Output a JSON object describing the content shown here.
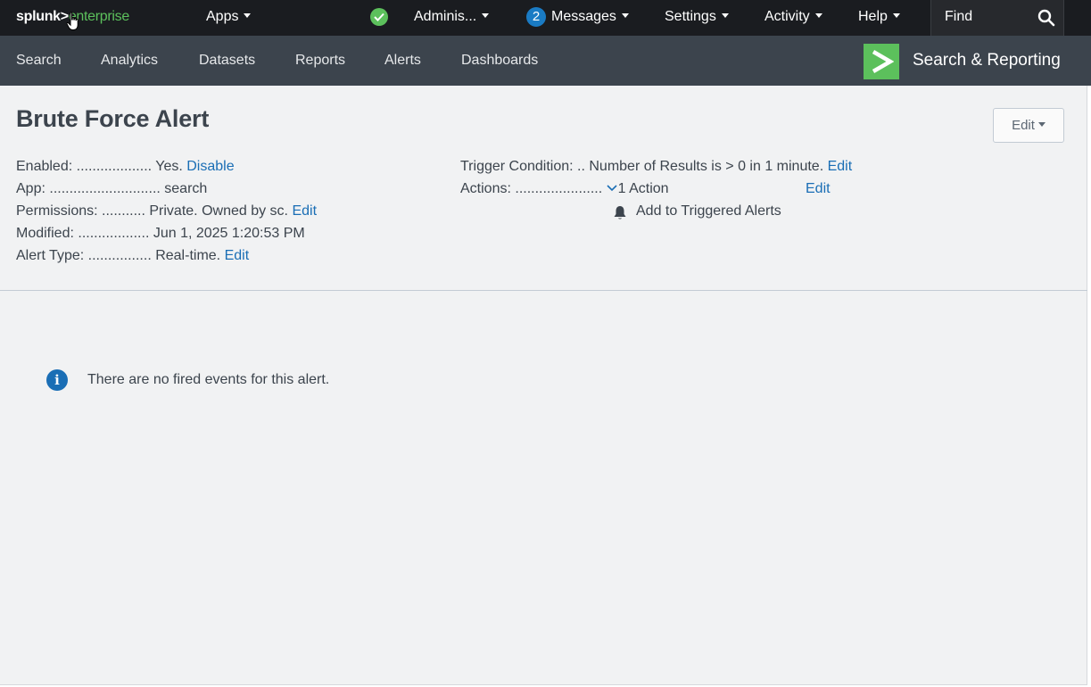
{
  "topbar": {
    "brand_primary": "splunk>",
    "brand_secondary": "enterprise",
    "apps_label": "Apps",
    "admin_label": "Adminis...",
    "messages_count": "2",
    "messages_label": "Messages",
    "settings_label": "Settings",
    "activity_label": "Activity",
    "help_label": "Help",
    "find_label": "Find",
    "status_icon": "check-circle-icon",
    "search_icon": "search-icon"
  },
  "appbar": {
    "nav": [
      "Search",
      "Analytics",
      "Datasets",
      "Reports",
      "Alerts",
      "Dashboards"
    ],
    "app_title": "Search & Reporting",
    "app_icon": "chevron-right-logo"
  },
  "alert": {
    "title": "Brute Force Alert",
    "edit_button": "Edit",
    "enabled_label": "Enabled:",
    "enabled_value": "Yes.",
    "enabled_link": "Disable",
    "app_label": "App:",
    "app_value": "search",
    "permissions_label": "Permissions:",
    "permissions_value": "Private. Owned by sc.",
    "permissions_link": "Edit",
    "modified_label": "Modified:",
    "modified_value": "Jun 1, 2025 1:20:53 PM",
    "type_label": "Alert Type:",
    "type_value": "Real-time.",
    "type_link": "Edit",
    "trigger_label": "Trigger Condition:",
    "trigger_value": "Number of Results is > 0 in 1 minute.",
    "trigger_link": "Edit",
    "actions_label": "Actions:",
    "actions_value": "1 Action",
    "actions_link": "Edit",
    "action_item": "Add to Triggered Alerts"
  },
  "events": {
    "empty_message": "There are no fired events for this alert."
  },
  "colors": {
    "topbar_bg": "#1a1c20",
    "appbar_bg": "#3c444d",
    "brand_green": "#5cc05c",
    "link_blue": "#1a6eb5",
    "page_bg": "#f1f2f3"
  }
}
